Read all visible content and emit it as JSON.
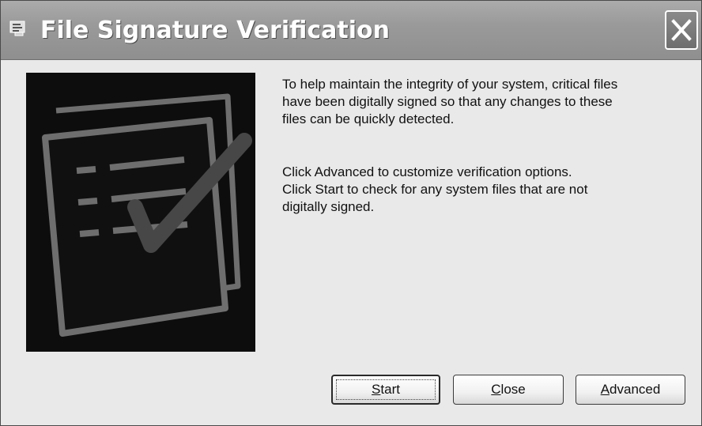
{
  "window": {
    "title": "File Signature Verification",
    "title_icon": "file-verification-icon",
    "close_icon": "close-icon"
  },
  "picture": {
    "icon": "signed-document-checkmark-icon"
  },
  "description": {
    "paragraph1": [
      "To help maintain the integrity of your system, critical files",
      "have been digitally signed so that any changes to these",
      "files can be quickly detected."
    ],
    "paragraph2": [
      "Click Advanced to customize verification options.",
      "Click Start to check for any system files that are not",
      "digitally signed."
    ]
  },
  "buttons": {
    "start": {
      "accel": "S",
      "rest": "tart"
    },
    "close": {
      "accel": "C",
      "rest": "lose"
    },
    "advanced": {
      "accel": "A",
      "rest": "dvanced"
    }
  },
  "colors": {
    "titlebar": "#9a9a9a",
    "dialog_background": "#e9e9e9",
    "picture_background": "#0d0d0d",
    "picture_strokes": "#6e6e6e"
  }
}
